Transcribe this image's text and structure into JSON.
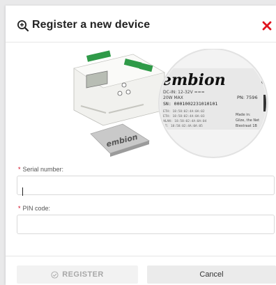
{
  "modal": {
    "title": "Register a new device",
    "illustration": {
      "brand": "embion",
      "label_lines": [
        "DC-IN: 12-32V ===",
        "20W MAX",
        "SN: 0001002231010101"
      ],
      "pn_label": "PN: 7596",
      "mac_lines": [
        "ETH: 18:58:02:4A:0A:02",
        "ETH: 18:58:02:4A:0A:03",
        "WLAN: 18:58:02:4A:0A:04",
        "BT: 18:58:02:4A:0A:05"
      ],
      "made_in": [
        "Made in:",
        "Gilze, the Net",
        "Biestraat 1B"
      ],
      "device_logo": "embion"
    },
    "serial": {
      "label": "Serial number:",
      "required_mark": "*",
      "value": "",
      "placeholder": ""
    },
    "pin": {
      "label": "PIN code:",
      "required_mark": "*",
      "value": "",
      "placeholder": ""
    },
    "buttons": {
      "register": "REGISTER",
      "cancel": "Cancel"
    }
  },
  "colors": {
    "close": "#e0141e",
    "required": "#d0021b",
    "disabled_text": "#a8a8a8"
  }
}
